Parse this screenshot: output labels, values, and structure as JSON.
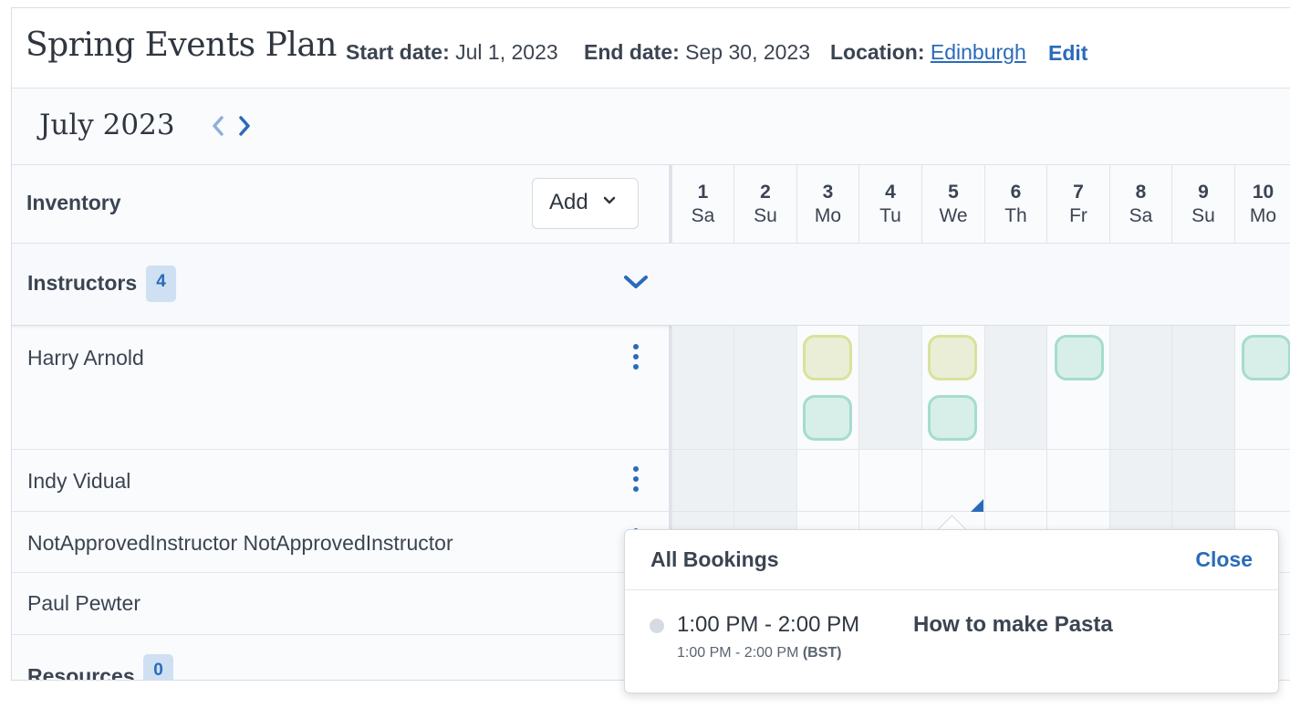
{
  "header": {
    "title": "Spring Events Plan",
    "start_label": "Start date:",
    "start_value": "Jul 1, 2023",
    "end_label": "End date:",
    "end_value": "Sep 30, 2023",
    "location_label": "Location:",
    "location_value": "Edinburgh",
    "edit_label": "Edit"
  },
  "calendar": {
    "month": "July 2023",
    "days": [
      {
        "num": "1",
        "dow": "Sa"
      },
      {
        "num": "2",
        "dow": "Su"
      },
      {
        "num": "3",
        "dow": "Mo"
      },
      {
        "num": "4",
        "dow": "Tu"
      },
      {
        "num": "5",
        "dow": "We"
      },
      {
        "num": "6",
        "dow": "Th"
      },
      {
        "num": "7",
        "dow": "Fr"
      },
      {
        "num": "8",
        "dow": "Sa"
      },
      {
        "num": "9",
        "dow": "Su"
      },
      {
        "num": "10",
        "dow": "Mo"
      }
    ]
  },
  "inventory": {
    "label": "Inventory",
    "add_label": "Add"
  },
  "groups": {
    "instructors": {
      "label": "Instructors",
      "count": "4"
    },
    "resources": {
      "label": "Resources",
      "count": "0"
    }
  },
  "instructors": [
    {
      "name": "Harry Arnold"
    },
    {
      "name": "Indy Vidual"
    },
    {
      "name": "NotApprovedInstructor NotApprovedInstructor"
    },
    {
      "name": "Paul Pewter"
    }
  ],
  "popup": {
    "title": "All Bookings",
    "close_label": "Close",
    "booking": {
      "time": "1:00 PM - 2:00 PM",
      "local_time": "1:00 PM - 2:00 PM",
      "timezone": "(BST)",
      "title": "How to make Pasta"
    }
  },
  "colors": {
    "accent": "#2a6bb8",
    "chip_yellow": "#d8e29c",
    "chip_green": "#a5dccd",
    "weekend_bg": "#eef1f4"
  }
}
